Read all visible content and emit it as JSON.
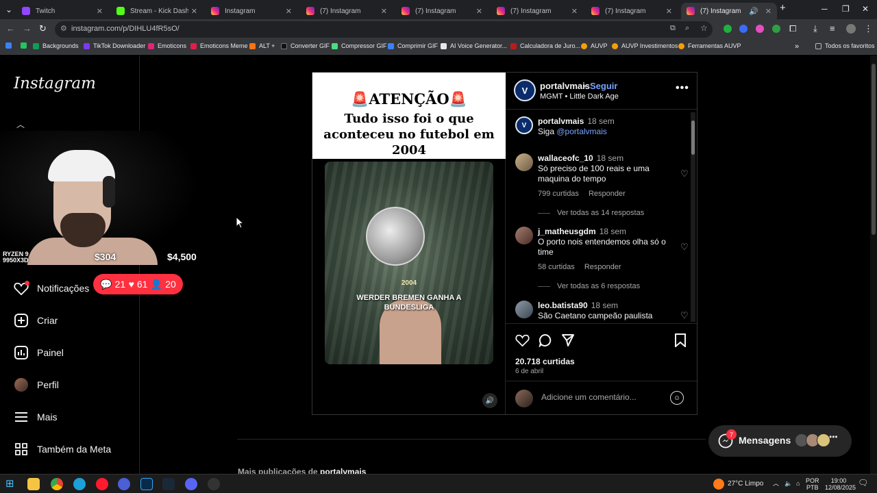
{
  "browser": {
    "tabs": [
      {
        "title": "Twitch",
        "favicon": "twitch-icon"
      },
      {
        "title": "Stream - Kick Dashboard",
        "favicon": "kick-icon"
      },
      {
        "title": "Instagram",
        "favicon": "instagram-icon"
      },
      {
        "title": "(7) Instagram",
        "favicon": "instagram-icon"
      },
      {
        "title": "(7) Instagram",
        "favicon": "instagram-icon"
      },
      {
        "title": "(7) Instagram",
        "favicon": "instagram-icon"
      },
      {
        "title": "(7) Instagram",
        "favicon": "instagram-icon"
      },
      {
        "title": "(7) Instagram",
        "favicon": "instagram-icon"
      }
    ],
    "url": "instagram.com/p/DIHLU4fR5sO/",
    "bookmarks": [
      "Backgrounds",
      "TikTok Downloader",
      "Emoticons",
      "Emoticons Meme",
      "ALT +",
      "Converter GIF",
      "Compressor GIF",
      "Comprimir GIF",
      "AI Voice Generator...",
      "Calculadora de Juro...",
      "AUVP",
      "AUVP Investimentos",
      "Ferramentas AUVP"
    ],
    "all_favorites": "Todos os favoritos"
  },
  "sidebar": {
    "logo": "Instagram",
    "webcam": {
      "cpu": "RYZEN 9 9950X3D",
      "value_left": "$304",
      "value_right": "$4,500"
    },
    "items": [
      {
        "label": "Notificações",
        "icon": "heart-icon"
      },
      {
        "label": "Criar",
        "icon": "plus-square-icon"
      },
      {
        "label": "Painel",
        "icon": "chart-icon"
      },
      {
        "label": "Perfil",
        "icon": "avatar"
      },
      {
        "label": "Mais",
        "icon": "menu-icon"
      },
      {
        "label": "Também da Meta",
        "icon": "threads-icon"
      }
    ],
    "notif_counts": {
      "comments": "21",
      "likes": "61",
      "follows": "20"
    }
  },
  "post": {
    "media": {
      "headline": "ATENÇÃO",
      "subtitle": "Tudo isso foi o que aconteceu no futebol em 2004",
      "video_year": "2004",
      "video_caption": "WERDER BREMEN GANHA A BUNDESLIGA"
    },
    "header": {
      "username": "portalvmais",
      "follow": "Seguir",
      "music": "MGMT • Little Dark Age"
    },
    "caption": {
      "username": "portalvmais",
      "time": "18 sem",
      "text_prefix": "Siga ",
      "mention": "@portalvmais"
    },
    "comments": [
      {
        "username": "wallaceofc_10",
        "time": "18 sem",
        "text": "Só preciso de 100 reais e uma maquina do tempo",
        "likes": "799 curtidas",
        "reply": "Responder",
        "view_replies": "Ver todas as 14 respostas"
      },
      {
        "username": "j_matheusgdm",
        "time": "18 sem",
        "text": "O porto nois entendemos olha só o time",
        "likes": "58 curtidas",
        "reply": "Responder",
        "view_replies": "Ver todas as 6 respostas"
      },
      {
        "username": "leo.batista90",
        "time": "18 sem",
        "text": "São Caetano campeão paulista"
      }
    ],
    "like_count": "20.718 curtidas",
    "date": "6 de abril",
    "comment_placeholder": "Adicione um comentário..."
  },
  "more_posts": {
    "prefix": "Mais publicações de ",
    "username": "portalvmais"
  },
  "messages": {
    "label": "Mensagens",
    "badge": "7"
  },
  "taskbar": {
    "temp": "27°C Limpo",
    "lang1": "POR",
    "lang2": "PTB",
    "time": "19:00",
    "date": "12/08/2025"
  },
  "colors": {
    "accent": "#0095f6",
    "notify": "#ff3040",
    "bg": "#000000"
  }
}
